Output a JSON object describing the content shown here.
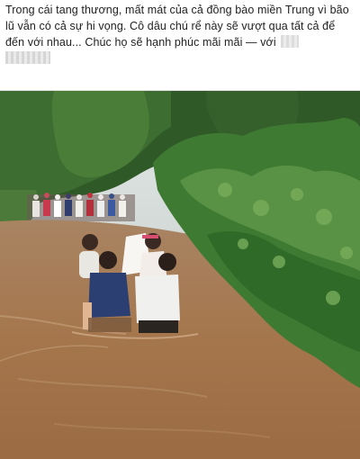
{
  "post": {
    "text_main": "Trong cái tang thương, mất mát của cả đồng bào miền Trung vì bão lũ vẫn có cả sự hi vọng. Cô dâu chú rể này sẽ vượt qua tất cả để đến với nhau... Chúc họ sẽ hạnh phúc mãi mãi",
    "with_text": " — với ",
    "tagged_icon": "blurred-name-icon"
  },
  "photo": {
    "subject": "flood-wedding-photo-icon",
    "colors": {
      "water": "#a5774f",
      "foliage": "#3f7a33",
      "sky": "#cfd8d6"
    }
  }
}
